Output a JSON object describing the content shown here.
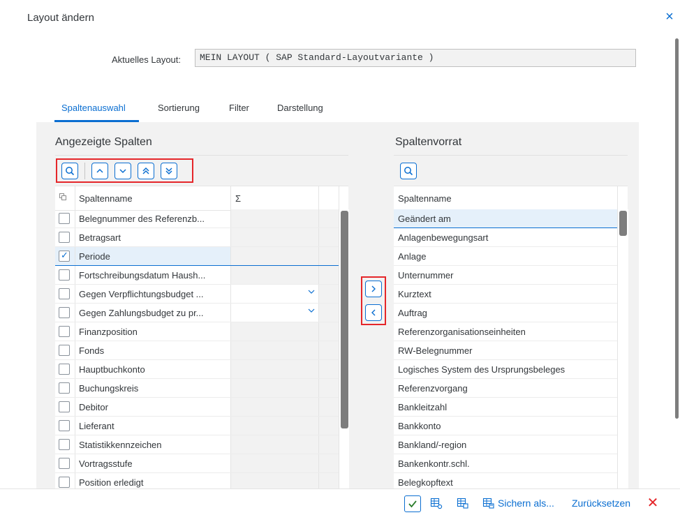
{
  "dialog": {
    "title": "Layout ändern",
    "close": "×"
  },
  "current_layout": {
    "label": "Aktuelles Layout:",
    "value": "MEIN LAYOUT ( SAP Standard-Layoutvariante )"
  },
  "tabs": [
    {
      "label": "Spaltenauswahl",
      "active": true
    },
    {
      "label": "Sortierung"
    },
    {
      "label": "Filter"
    },
    {
      "label": "Darstellung"
    }
  ],
  "left": {
    "title": "Angezeigte Spalten",
    "col_name": "Spaltenname",
    "col_sum": "Σ",
    "rows": [
      {
        "label": "Belegnummer des Referenzb...",
        "checked": false
      },
      {
        "label": "Betragsart",
        "checked": false
      },
      {
        "label": "Periode",
        "checked": true,
        "selected": true
      },
      {
        "label": "Fortschreibungsdatum Haush...",
        "checked": false
      },
      {
        "label": "Gegen Verpflichtungsbudget ...",
        "checked": false,
        "dropdown": true
      },
      {
        "label": "Gegen Zahlungsbudget zu pr...",
        "checked": false,
        "dropdown": true
      },
      {
        "label": "Finanzposition",
        "checked": false
      },
      {
        "label": "Fonds",
        "checked": false
      },
      {
        "label": "Hauptbuchkonto",
        "checked": false
      },
      {
        "label": "Buchungskreis",
        "checked": false
      },
      {
        "label": "Debitor",
        "checked": false
      },
      {
        "label": "Lieferant",
        "checked": false
      },
      {
        "label": "Statistikkennzeichen",
        "checked": false
      },
      {
        "label": "Vortragsstufe",
        "checked": false
      },
      {
        "label": "Position erledigt",
        "checked": false
      }
    ]
  },
  "right": {
    "title": "Spaltenvorrat",
    "col_name": "Spaltenname",
    "rows": [
      {
        "label": "Geändert am",
        "selected": true
      },
      {
        "label": "Anlagenbewegungsart"
      },
      {
        "label": "Anlage"
      },
      {
        "label": "Unternummer"
      },
      {
        "label": "Kurztext"
      },
      {
        "label": "Auftrag"
      },
      {
        "label": "Referenzorganisationseinheiten"
      },
      {
        "label": "RW-Belegnummer"
      },
      {
        "label": "Logisches System des Ursprungsbeleges"
      },
      {
        "label": "Referenzvorgang"
      },
      {
        "label": "Bankleitzahl"
      },
      {
        "label": "Bankkonto"
      },
      {
        "label": "Bankland/-region"
      },
      {
        "label": "Bankenkontr.schl."
      },
      {
        "label": "Belegkopftext"
      }
    ]
  },
  "footer": {
    "save_as": "Sichern als...",
    "reset": "Zurücksetzen"
  },
  "colors": {
    "accent": "#0a6ed1",
    "highlight_box": "#e5262a",
    "selected_row": "#e5f0fa"
  }
}
